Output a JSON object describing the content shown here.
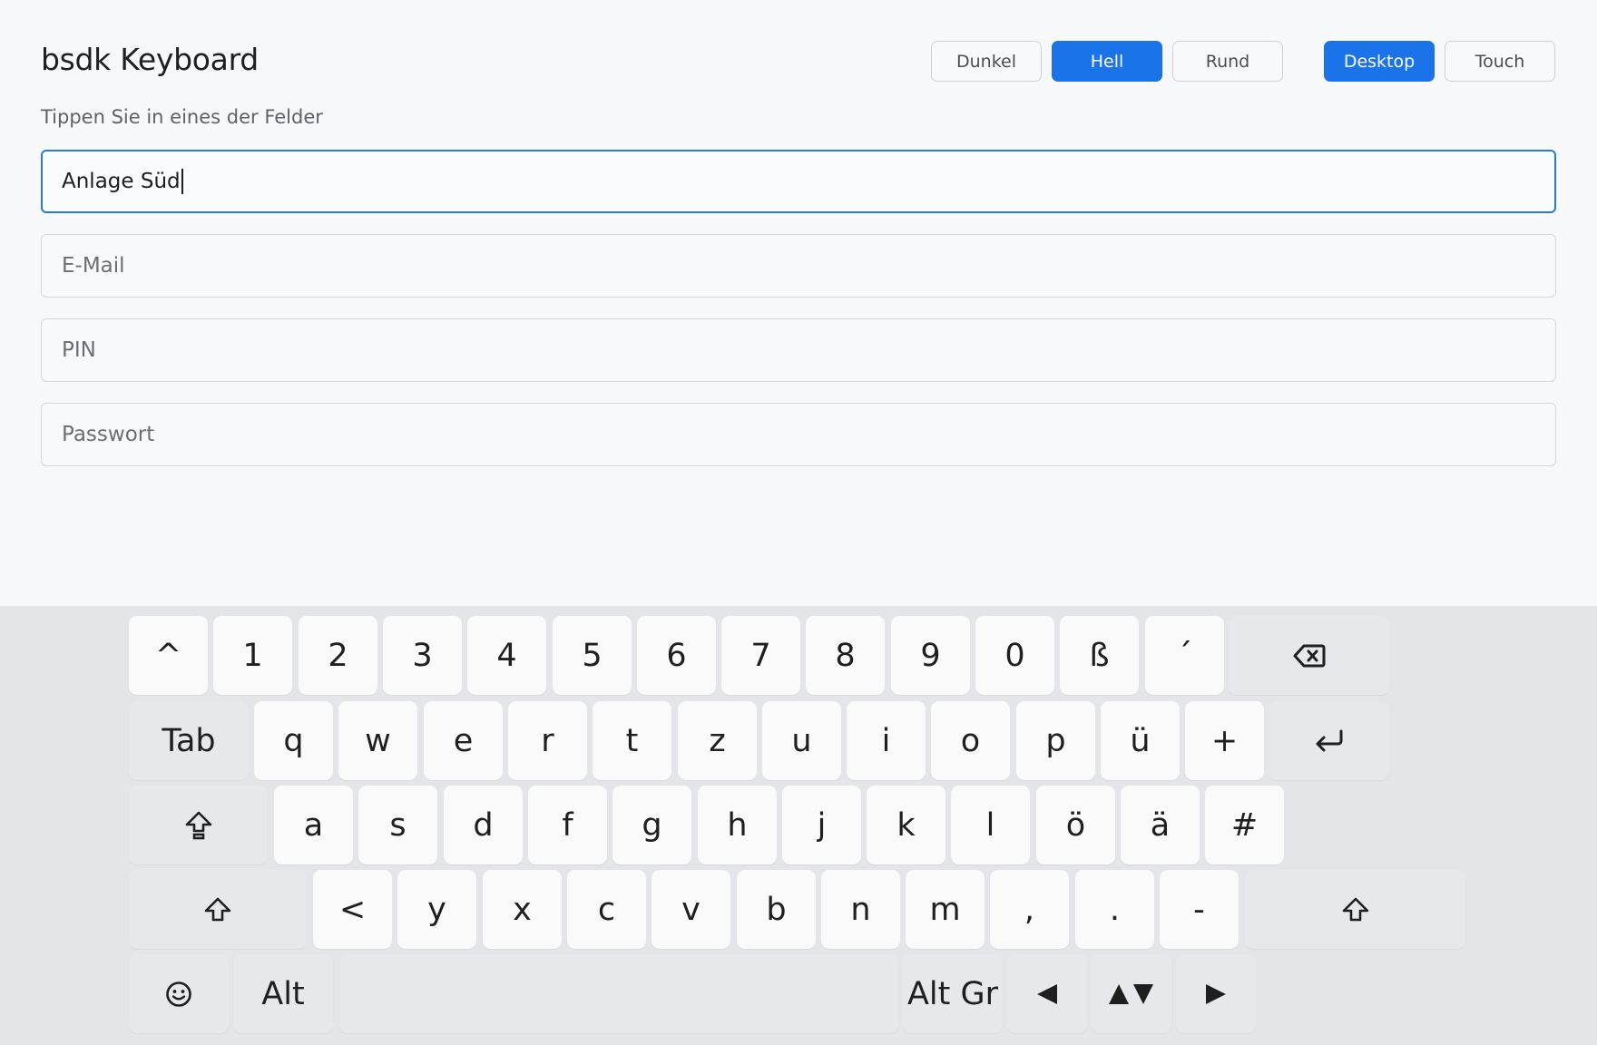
{
  "app": {
    "title": "bsdk Keyboard",
    "subtitle": "Tippen Sie in eines der Felder"
  },
  "toolbar": {
    "theme_buttons": [
      {
        "label": "Dunkel",
        "active": false
      },
      {
        "label": "Hell",
        "active": true
      },
      {
        "label": "Rund",
        "active": false
      }
    ],
    "mode_buttons": [
      {
        "label": "Desktop",
        "active": true
      },
      {
        "label": "Touch",
        "active": false
      }
    ]
  },
  "fields": [
    {
      "value": "Anlage Süd",
      "placeholder": "",
      "focused": true
    },
    {
      "value": "",
      "placeholder": "E-Mail",
      "focused": false
    },
    {
      "value": "",
      "placeholder": "PIN",
      "focused": false
    },
    {
      "value": "",
      "placeholder": "Passwort",
      "focused": false
    }
  ],
  "keyboard": {
    "row1": [
      "^",
      "1",
      "2",
      "3",
      "4",
      "5",
      "6",
      "7",
      "8",
      "9",
      "0",
      "ß",
      "´"
    ],
    "row2": [
      "q",
      "w",
      "e",
      "r",
      "t",
      "z",
      "u",
      "i",
      "o",
      "p",
      "ü",
      "+"
    ],
    "row3": [
      "a",
      "s",
      "d",
      "f",
      "g",
      "h",
      "j",
      "k",
      "l",
      "ö",
      "ä",
      "#"
    ],
    "row4": [
      "<",
      "y",
      "x",
      "c",
      "v",
      "b",
      "n",
      "m",
      ",",
      ".",
      "-"
    ],
    "tab_label": "Tab",
    "alt_label": "Alt",
    "altgr_label": "Alt Gr",
    "icons": {
      "backspace": "backspace-icon",
      "enter": "enter-icon",
      "capslock": "capslock-icon",
      "shift": "shift-icon",
      "emoji": "emoji-icon",
      "left": "arrow-left-icon",
      "updown": "arrow-up-down-icon",
      "right": "arrow-right-icon"
    }
  },
  "colors": {
    "accent": "#1a73e8",
    "key": "#fafafa",
    "modifier_key": "#e6e8ec",
    "keyboard_bg": "#e3e5e9"
  }
}
